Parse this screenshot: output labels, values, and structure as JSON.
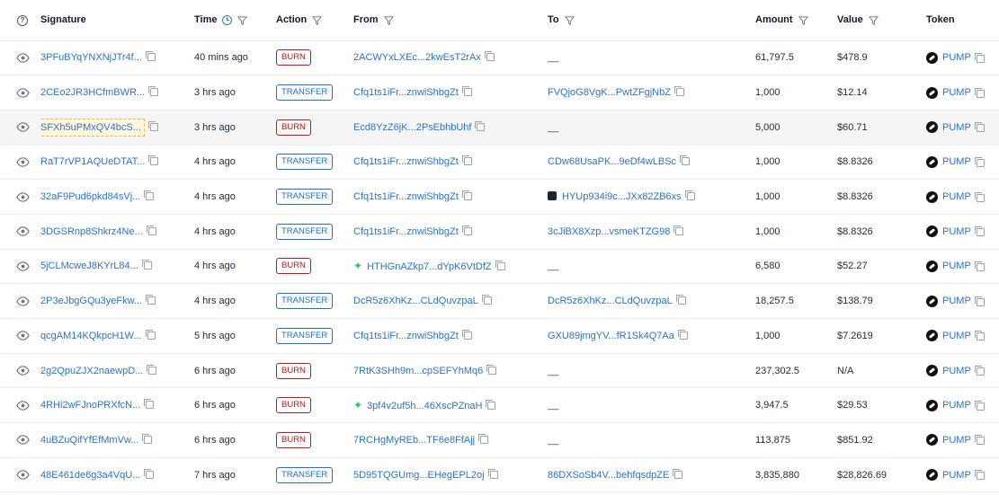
{
  "header": {
    "help_icon": "question-circle-icon",
    "signature": "Signature",
    "time": "Time",
    "action": "Action",
    "from": "From",
    "to": "To",
    "amount": "Amount",
    "value": "Value",
    "token": "Token"
  },
  "colors": {
    "link": "#2a72c9",
    "burn": "#b91c1c",
    "transfer": "#1c6fcf",
    "highlight_bg": "#f5f5f5"
  },
  "rows": [
    {
      "signature": "3PFuBYqYNXNjJTr4f...",
      "time": "40 mins ago",
      "action": "BURN",
      "from": "2ACWYxLXEc...2kwEsT2rAx",
      "from_icon": "",
      "to": "__",
      "to_icon": "",
      "amount": "61,797.5",
      "value": "$478.9",
      "token": "PUMP"
    },
    {
      "signature": "2CEo2JR3HCfmBWR...",
      "time": "3 hrs ago",
      "action": "TRANSFER",
      "from": "Cfq1ts1iFr...znwiShbgZt",
      "from_icon": "",
      "to": "FVQjoG8VgK...PwtZFgjNbZ",
      "to_icon": "",
      "amount": "1,000",
      "value": "$12.14",
      "token": "PUMP"
    },
    {
      "signature": "SFXh5uPMxQV4bcS...",
      "time": "3 hrs ago",
      "action": "BURN",
      "from": "Ecd8YzZ6jK...2PsEbhbUhf",
      "from_icon": "",
      "to": "__",
      "to_icon": "",
      "amount": "5,000",
      "value": "$60.71",
      "token": "PUMP",
      "highlight": true
    },
    {
      "signature": "RaT7rVP1AQUeDTAT...",
      "time": "4 hrs ago",
      "action": "TRANSFER",
      "from": "Cfq1ts1iFr...znwiShbgZt",
      "from_icon": "",
      "to": "CDw68UsaPK...9eDf4wLBSc",
      "to_icon": "",
      "amount": "1,000",
      "value": "$8.8326",
      "token": "PUMP"
    },
    {
      "signature": "32aF9Pud6pkd84sVj...",
      "time": "4 hrs ago",
      "action": "TRANSFER",
      "from": "Cfq1ts1iFr...znwiShbgZt",
      "from_icon": "",
      "to": "HYUp934i9c...JXx82ZB6xs",
      "to_icon": "wallet",
      "amount": "1,000",
      "value": "$8.8326",
      "token": "PUMP"
    },
    {
      "signature": "3DGSRnp8Shkrz4Ne...",
      "time": "4 hrs ago",
      "action": "TRANSFER",
      "from": "Cfq1ts1iFr...znwiShbgZt",
      "from_icon": "",
      "to": "3cJiBX8Xzp...vsmeKTZG98",
      "to_icon": "",
      "amount": "1,000",
      "value": "$8.8326",
      "token": "PUMP"
    },
    {
      "signature": "5jCLMcweJ8KYrL84...",
      "time": "4 hrs ago",
      "action": "BURN",
      "from": "HTHGnAZkp7...dYpK6VtDfZ",
      "from_icon": "spark",
      "to": "__",
      "to_icon": "",
      "amount": "6,580",
      "value": "$52.27",
      "token": "PUMP"
    },
    {
      "signature": "2P3eJbgGQu3yeFkw...",
      "time": "4 hrs ago",
      "action": "TRANSFER",
      "from": "DcR5z6XhKz...CLdQuvzpaL",
      "from_icon": "",
      "to": "DcR5z6XhKz...CLdQuvzpaL",
      "to_icon": "",
      "amount": "18,257.5",
      "value": "$138.79",
      "token": "PUMP"
    },
    {
      "signature": "qcgAM14KQkpcH1W...",
      "time": "5 hrs ago",
      "action": "TRANSFER",
      "from": "Cfq1ts1iFr...znwiShbgZt",
      "from_icon": "",
      "to": "GXU89jmgYV...fR1Sk4Q7Aa",
      "to_icon": "",
      "amount": "1,000",
      "value": "$7.2619",
      "token": "PUMP"
    },
    {
      "signature": "2g2QpuZJX2naewpD...",
      "time": "6 hrs ago",
      "action": "BURN",
      "from": "7RtK3SHh9m...cpSEFYhMq6",
      "from_icon": "",
      "to": "__",
      "to_icon": "",
      "amount": "237,302.5",
      "value": "N/A",
      "token": "PUMP"
    },
    {
      "signature": "4RHi2wFJnoPRXfcN...",
      "time": "6 hrs ago",
      "action": "BURN",
      "from": "3pf4v2uf5h...46XscPZnaH",
      "from_icon": "spark",
      "to": "__",
      "to_icon": "",
      "amount": "3,947.5",
      "value": "$29.53",
      "token": "PUMP"
    },
    {
      "signature": "4uBZuQifYfEfMmVw...",
      "time": "6 hrs ago",
      "action": "BURN",
      "from": "7RCHgMyREb...TF6e8FfAjj",
      "from_icon": "",
      "to": "__",
      "to_icon": "",
      "amount": "113,875",
      "value": "$851.92",
      "token": "PUMP"
    },
    {
      "signature": "48E461de6g3a4VqU...",
      "time": "7 hrs ago",
      "action": "TRANSFER",
      "from": "5D95TQGUmg...EHegEPL2oj",
      "from_icon": "",
      "to": "86DXSoSb4V...behfqsdpZE",
      "to_icon": "",
      "amount": "3,835,880",
      "value": "$28,826.69",
      "token": "PUMP"
    }
  ]
}
